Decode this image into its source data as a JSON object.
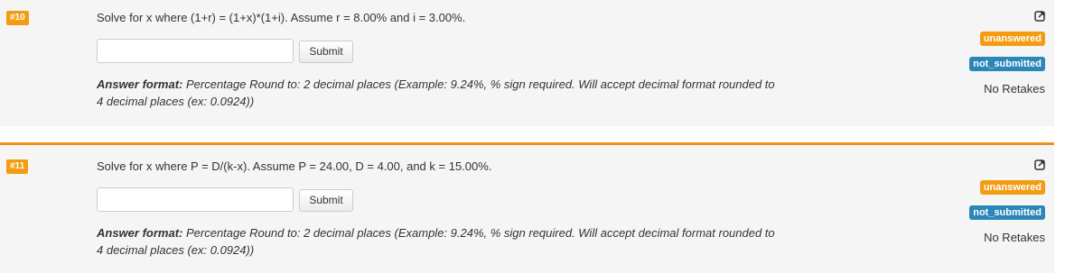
{
  "questions": [
    {
      "number": "#10",
      "prompt": "Solve for x where (1+r) = (1+x)*(1+i). Assume r = 8.00% and i = 3.00%.",
      "answer_value": "",
      "submit_label": "Submit",
      "format_label": "Answer format:",
      "format_text": "Percentage Round to: 2 decimal places (Example: 9.24%, % sign required. Will accept decimal format rounded to 4 decimal places (ex: 0.0924))",
      "status_badge": "unanswered",
      "submission_badge": "not_submitted",
      "retakes": "No Retakes",
      "icon": "external-link-icon"
    },
    {
      "number": "#11",
      "prompt": "Solve for x where P = D/(k-x). Assume P = 24.00, D = 4.00, and k = 15.00%.",
      "answer_value": "",
      "submit_label": "Submit",
      "format_label": "Answer format:",
      "format_text": "Percentage Round to: 2 decimal places (Example: 9.24%, % sign required. Will accept decimal format rounded to 4 decimal places (ex: 0.0924))",
      "status_badge": "unanswered",
      "submission_badge": "not_submitted",
      "retakes": "No Retakes",
      "icon": "external-link-icon"
    }
  ],
  "colors": {
    "number_badge": "#f39c12",
    "status_badge": "#f39c12",
    "submission_badge": "#2a87b8",
    "divider": "#f0901f",
    "panel_bg": "#f5f5f5"
  }
}
